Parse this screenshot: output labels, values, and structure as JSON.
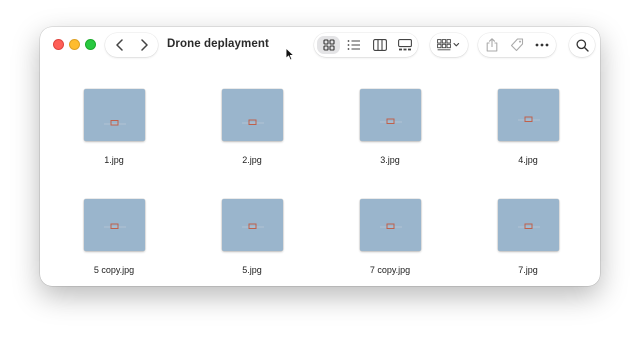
{
  "window": {
    "title": "Drone deplayment"
  },
  "toolbar": {
    "back_icon": "chevron-left-icon",
    "forward_icon": "chevron-right-icon",
    "views": [
      {
        "name": "icon-view",
        "icon": "grid-icon",
        "selected": true
      },
      {
        "name": "list-view",
        "icon": "list-icon",
        "selected": false
      },
      {
        "name": "column-view",
        "icon": "columns-icon",
        "selected": false
      },
      {
        "name": "gallery-view",
        "icon": "gallery-icon",
        "selected": false
      }
    ],
    "group_icon": "group-by-icon",
    "share_icon": "share-icon",
    "tag_icon": "tag-icon",
    "more_icon": "ellipsis-icon",
    "search_icon": "search-icon"
  },
  "files": [
    {
      "name": "1.jpg"
    },
    {
      "name": "2.jpg"
    },
    {
      "name": "3.jpg"
    },
    {
      "name": "4.jpg"
    },
    {
      "name": "5 copy.jpg"
    },
    {
      "name": "5.jpg"
    },
    {
      "name": "7 copy.jpg"
    },
    {
      "name": "7.jpg"
    }
  ],
  "colors": {
    "thumbnail_sky": "#9ab5cc",
    "drone": "#c0604a",
    "close": "#fe5f57",
    "minimize": "#febc2e",
    "maximize": "#28c840",
    "view_selected": "#e4e4e6"
  }
}
